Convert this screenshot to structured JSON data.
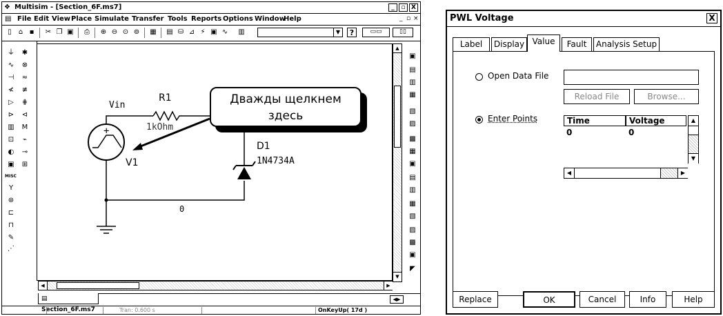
{
  "multisim": {
    "title": "Multisim - [Section_6F.ms7]",
    "window_controls": {
      "minimize": "_",
      "restore": "▫",
      "close": "X"
    },
    "menu": [
      "File",
      "Edit",
      "View",
      "Place",
      "Simulate",
      "Transfer",
      "Tools",
      "Reports",
      "Options",
      "Window",
      "Help"
    ],
    "toolbar_help": "?",
    "schematic": {
      "source_label": "Vin",
      "source_ref": "V1",
      "resistor_ref": "R1",
      "resistor_value": "1kOhm",
      "diode_ref": "D1",
      "diode_model": "1N4734A",
      "net_label": "0",
      "callout_line1": "Дважды щелкнем",
      "callout_line2": "здесь"
    },
    "left_palette_misc": "MISC",
    "tab_label": "Section_6F.ms7",
    "status": {
      "tran": "Tran: 0.600 s",
      "event": "OnKeyUp( 17d )"
    }
  },
  "pwl": {
    "title": "PWL Voltage",
    "close": "X",
    "tabs": [
      "Label",
      "Display",
      "Value",
      "Fault",
      "Analysis Setup"
    ],
    "active_tab": "Value",
    "open_data_file_label": "Open Data File",
    "open_data_file_value": "",
    "reload_label": "Reload File",
    "browse_label": "Browse...",
    "enter_points_label": "Enter Points",
    "grid": {
      "headers": [
        "Time",
        "Voltage"
      ],
      "rows": [
        [
          "0",
          "0"
        ]
      ]
    },
    "buttons": {
      "replace": "Replace",
      "ok": "OK",
      "cancel": "Cancel",
      "info": "Info",
      "help": "Help"
    }
  }
}
